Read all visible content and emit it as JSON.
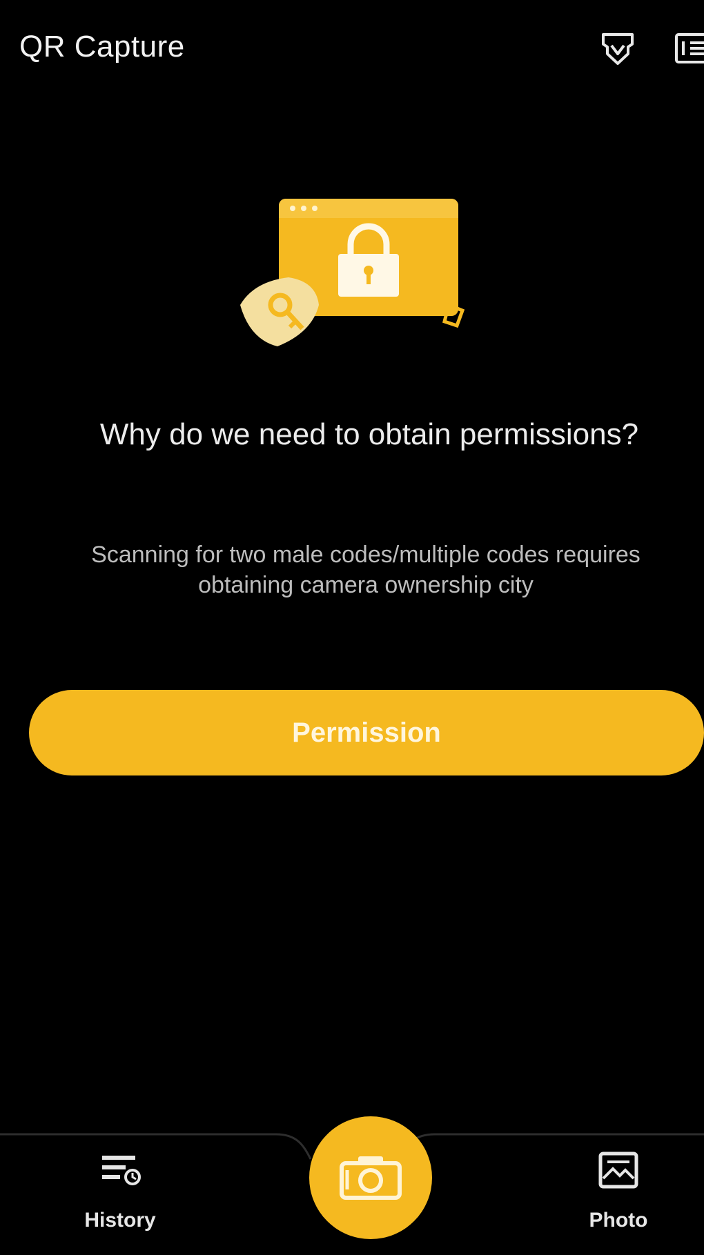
{
  "header": {
    "title": "QR Capture",
    "icons": [
      "vip-icon",
      "menu-icon"
    ]
  },
  "illustration": {
    "icons": [
      "lock-window-icon",
      "key-shield-icon"
    ]
  },
  "permission": {
    "heading": "Why do we need to obtain permissions?",
    "description": "Scanning for two male codes/multiple codes requires obtaining camera ownership city",
    "button_label": "Permission"
  },
  "bottom_nav": {
    "items": [
      {
        "label": "History",
        "icon": "history-icon"
      },
      {
        "label": "Photo",
        "icon": "photo-icon"
      }
    ],
    "center_icon": "camera-icon"
  },
  "colors": {
    "accent": "#f5b920",
    "background": "#000000"
  }
}
